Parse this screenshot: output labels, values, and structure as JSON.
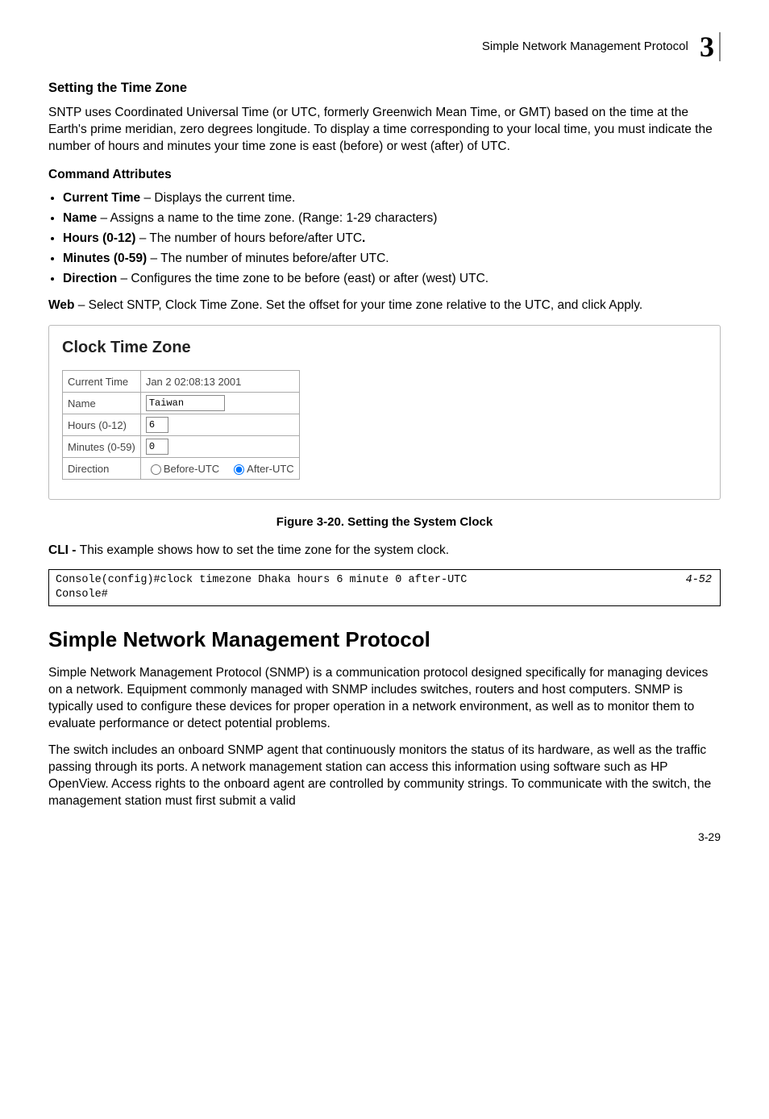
{
  "header": {
    "running": "Simple Network Management Protocol",
    "chapter_num": "3"
  },
  "h3_title": "Setting the Time Zone",
  "p1": "SNTP uses Coordinated Universal Time (or UTC, formerly Greenwich Mean Time, or GMT) based on the time at the Earth's prime meridian, zero degrees longitude. To display a time corresponding to your local time, you must indicate the number of hours and minutes your time zone is east (before) or west (after) of UTC.",
  "h4_cmd": "Command Attributes",
  "bullets": [
    {
      "name": "Current Time",
      "desc": " – Displays the current time."
    },
    {
      "name": "Name",
      "desc": " – Assigns a name to the time zone. (Range: 1-29 characters)"
    },
    {
      "name": "Hours (0-12)",
      "desc": " – The number of hours before/after UTC"
    },
    {
      "name": "Minutes (0-59)",
      "desc": " – The number of minutes before/after UTC."
    },
    {
      "name": "Direction",
      "desc": " – Configures the time zone to be before (east) or after (west) UTC."
    }
  ],
  "web_line_prefix": "Web",
  "web_line_desc": " – Select SNTP, Clock Time Zone. Set the offset for your time zone relative to the UTC, and click Apply.",
  "panel": {
    "title": "Clock Time Zone",
    "rows": {
      "current_time_label": "Current Time",
      "current_time_value": "Jan 2 02:08:13 2001",
      "name_label": "Name",
      "name_value": "Taiwan",
      "hours_label": "Hours (0-12)",
      "hours_value": "6",
      "minutes_label": "Minutes (0-59)",
      "minutes_value": "0",
      "direction_label": "Direction",
      "radio_before": "Before-UTC",
      "radio_after": "After-UTC"
    }
  },
  "fig_caption": "Figure 3-20.  Setting the System Clock",
  "cli_prefix": "CLI - ",
  "cli_text": "This example shows how to set the time zone for the system clock.",
  "code": {
    "line1": "Console(config)#clock timezone Dhaka hours 6 minute 0 after-UTC",
    "line2": "Console#",
    "ref": "4-52"
  },
  "h1_section": "Simple Network Management Protocol",
  "p2": "Simple Network Management Protocol (SNMP) is a communication protocol designed specifically for managing devices on a network. Equipment commonly managed with SNMP includes switches, routers and host computers. SNMP is typically used to configure these devices for proper operation in a network environment, as well as to monitor them to evaluate performance or detect potential problems.",
  "p3": "The switch includes an onboard SNMP agent that continuously monitors the status of its hardware, as well as the traffic passing through its ports. A network management station can access this information using software such as HP OpenView. Access rights to the onboard agent are controlled by community strings. To communicate with the switch, the management station must first submit a valid",
  "page_num": "3-29"
}
